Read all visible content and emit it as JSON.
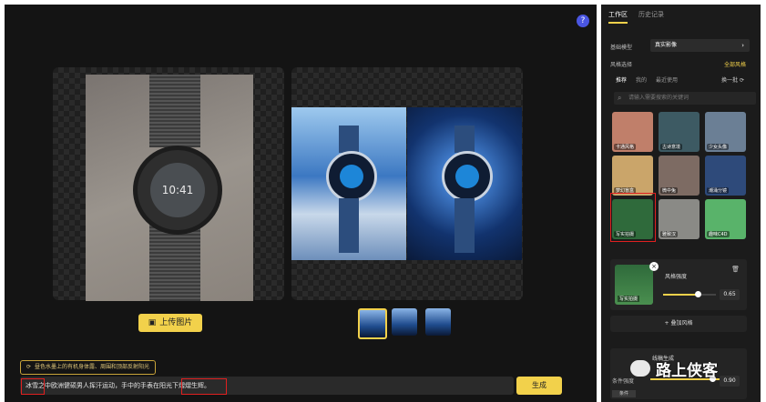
{
  "help": {
    "label": "?"
  },
  "left_panel": {
    "watch_time": "10:41"
  },
  "toolbar": {
    "upload_label": "上传图片",
    "generate_label": "生成"
  },
  "tip": {
    "text": "昼色水墨上的有机身体露、周围和顶部反射阳光"
  },
  "prompt": {
    "value": "冰雪之中欧洲健硕男人挥汗运动，手中的手表在阳光下熠熠生辉。"
  },
  "sidebar": {
    "tabs": [
      {
        "label": "工作区"
      },
      {
        "label": "历史记录"
      }
    ],
    "base_model_label": "基础模型",
    "base_model_value": "真实影像",
    "style_label": "风格选择",
    "all_styles": "全部风格",
    "subtabs": [
      {
        "label": "推荐"
      },
      {
        "label": "我的"
      },
      {
        "label": "最近使用"
      }
    ],
    "swap_label": "换一批",
    "search_placeholder": "请输入需要搜索的关键词",
    "styles": [
      {
        "label": "卡通风格",
        "color": "#c07f6a"
      },
      {
        "label": "古诗意境",
        "color": "#3d5a63"
      },
      {
        "label": "少女头像",
        "color": "#6b7f95"
      },
      {
        "label": "梦幻盲盒",
        "color": "#caa56a"
      },
      {
        "label": "微中兔",
        "color": "#7d6b63"
      },
      {
        "label": "潮涌分镜",
        "color": "#2e4a7a"
      },
      {
        "label": "写实拍摄",
        "color": "#2f6a3b"
      },
      {
        "label": "雅致汉",
        "color": "#8a8a86"
      },
      {
        "label": "趣味C4D",
        "color": "#59b36a"
      }
    ],
    "strength_label": "风格强度",
    "strength_value": "0.65",
    "strength_level": 0.65,
    "strength_thumb_label": "写实拍摄",
    "add_style_label": "叠加风格",
    "condition_label": "条件强度",
    "condition_value": "0.90",
    "condition_level": 0.9,
    "condition_mode": "线稿生成",
    "condition_tag_label": "条件"
  },
  "watermark": {
    "text": "路上侠客"
  }
}
